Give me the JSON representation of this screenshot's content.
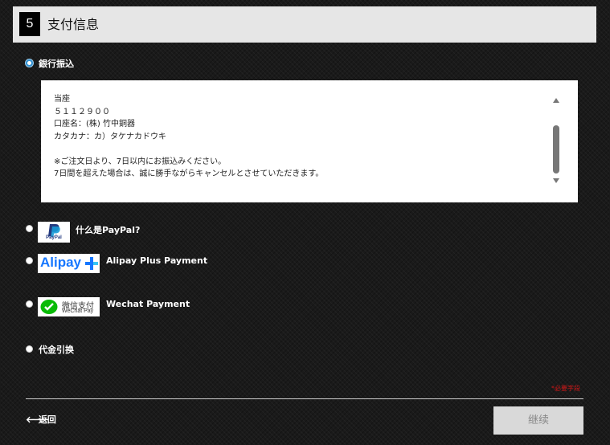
{
  "step": {
    "number": "5",
    "title": "支付信息"
  },
  "payment_options": {
    "bank": {
      "label": "銀行振込",
      "selected": true
    },
    "paypal": {
      "label": "什么是PayPal?",
      "logo_text": "PayPal",
      "selected": false
    },
    "alipay": {
      "label": "Alipay Plus Payment",
      "logo_text": "Alipay",
      "selected": false
    },
    "wechat": {
      "label": "Wechat Payment",
      "logo_text_cn": "微信支付",
      "logo_text_en": "WeChat Pay",
      "selected": false
    },
    "cod": {
      "label": "代金引换",
      "selected": false
    }
  },
  "bank_info": {
    "lines": [
      "当座",
      "５１１２９００",
      "口座名：(株) 竹中銅器",
      "カタカナ：カ）タケナカドウキ",
      "",
      "※ご注文日より、7日以内にお振込みください。",
      "7日間を超えた場合は、誠に勝手ながらキャンセルとさせていただきます。"
    ]
  },
  "colors": {
    "required": "#d01818",
    "selected_radio": "#2f8fd0",
    "alipay_blue": "#1677ff",
    "wechat_green": "#09bb07"
  },
  "required_note": "*必要字段",
  "back_label": "返回",
  "continue_label": "继续"
}
